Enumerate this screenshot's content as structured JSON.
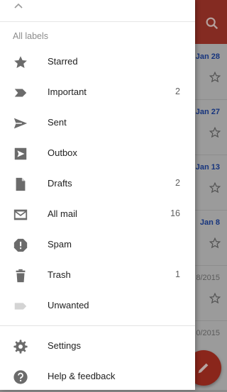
{
  "drawer": {
    "section_header": "All labels",
    "labels": [
      {
        "label": "Starred",
        "icon": "star-icon",
        "count": ""
      },
      {
        "label": "Important",
        "icon": "important-icon",
        "count": "2"
      },
      {
        "label": "Sent",
        "icon": "send-icon",
        "count": ""
      },
      {
        "label": "Outbox",
        "icon": "outbox-icon",
        "count": ""
      },
      {
        "label": "Drafts",
        "icon": "draft-icon",
        "count": "2"
      },
      {
        "label": "All mail",
        "icon": "all-mail-icon",
        "count": "16"
      },
      {
        "label": "Spam",
        "icon": "spam-icon",
        "count": ""
      },
      {
        "label": "Trash",
        "icon": "trash-icon",
        "count": "1"
      },
      {
        "label": "Unwanted",
        "icon": "label-icon",
        "count": ""
      }
    ],
    "footer": [
      {
        "label": "Settings",
        "icon": "gear-icon"
      },
      {
        "label": "Help & feedback",
        "icon": "help-icon"
      }
    ]
  },
  "background": {
    "dates": [
      "Jan 28",
      "Jan 27",
      "Jan 13",
      "Jan 8",
      "8/2015",
      "0/2015"
    ],
    "accent": "#b03a2e"
  }
}
